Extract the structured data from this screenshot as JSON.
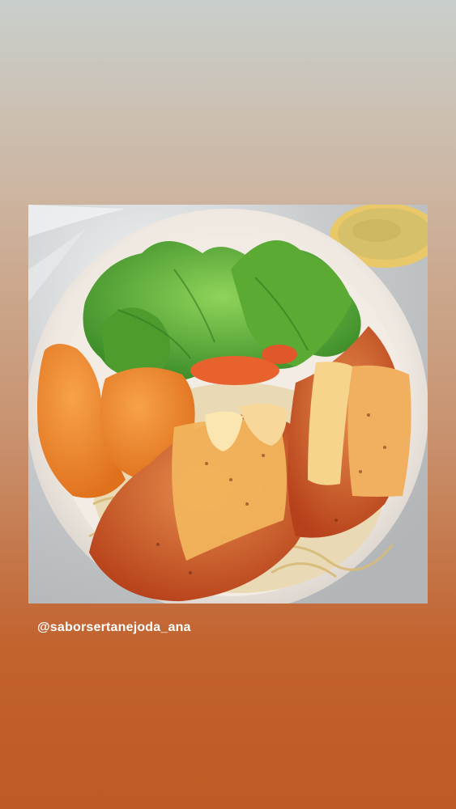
{
  "story": {
    "background_top_color": "#c9cfcc",
    "background_bottom_color": "#bd5a25",
    "caption_handle": "@saborsertanejoda_ana"
  }
}
